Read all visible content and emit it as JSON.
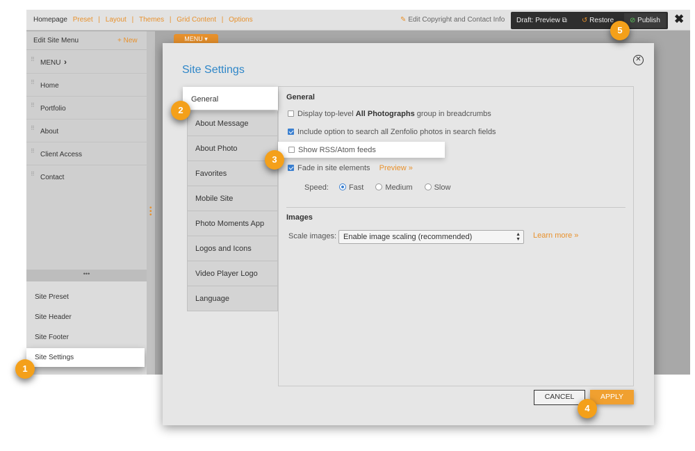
{
  "topbar": {
    "nav": [
      "Homepage",
      "Preset",
      "Layout",
      "Themes",
      "Grid Content",
      "Options"
    ],
    "copyright_link": "Edit Copyright and Contact Info",
    "draft_preview": "Draft: Preview",
    "restore": "Restore",
    "publish": "Publish",
    "close": "✖"
  },
  "sidebar": {
    "title": "Edit Site Menu",
    "new_label": "New",
    "menu_items": [
      "MENU",
      "Home",
      "Portfolio",
      "About",
      "Client Access",
      "Contact"
    ],
    "more": "•••",
    "bottom_items": [
      "Site Preset",
      "Site Header",
      "Site Footer",
      "Site Settings"
    ]
  },
  "canvas": {
    "menu_button": "MENU ▾"
  },
  "dialog": {
    "title": "Site Settings",
    "tabs": [
      "General",
      "About Message",
      "About Photo",
      "Favorites",
      "Mobile Site",
      "Photo Moments App",
      "Logos and Icons",
      "Video Player Logo",
      "Language"
    ],
    "active_tab": "General",
    "general": {
      "heading": "General",
      "opt1_pre": "Display top-level ",
      "opt1_bold": "All Photographs",
      "opt1_post": " group in breadcrumbs",
      "opt1_checked": false,
      "opt2": "Include option to search all Zenfolio photos in search fields",
      "opt2_checked": true,
      "opt3": "Show RSS/Atom feeds",
      "opt3_checked": false,
      "opt4": "Fade in site elements",
      "opt4_checked": true,
      "preview_link": "Preview »",
      "speed_label": "Speed:",
      "speed_options": [
        "Fast",
        "Medium",
        "Slow"
      ],
      "speed_selected": "Fast"
    },
    "images": {
      "heading": "Images",
      "scale_label": "Scale images:",
      "scale_value": "Enable image scaling (recommended)",
      "learn_more": "Learn more »"
    },
    "cancel": "CANCEL",
    "apply": "APPLY"
  },
  "callouts": [
    "1",
    "2",
    "3",
    "4",
    "5"
  ],
  "colors": {
    "accent": "#e8912c",
    "title_blue": "#2e86c8",
    "badge": "#f4a01a",
    "checkbox": "#3a7fd0"
  }
}
